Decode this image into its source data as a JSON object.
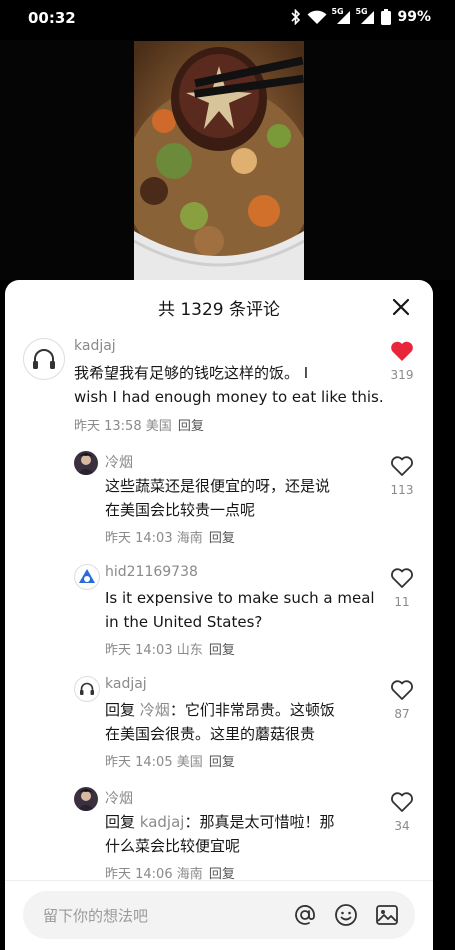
{
  "status_bar": {
    "time": "00:32",
    "signal1": "5G",
    "signal2": "5G",
    "battery": "99%"
  },
  "sheet": {
    "title": "共 1329 条评论"
  },
  "comments": [
    {
      "user": "kadjaj",
      "text_line1": "我希望我有足够的钱吃这样的饭。 I",
      "text_line2": "wish I had enough money to eat like this.",
      "time": "昨天 13:58",
      "location": "美国",
      "reply_label": "回复",
      "likes": "319",
      "liked": true
    },
    {
      "user": "冷烟",
      "text_line1": "这些蔬菜还是很便宜的呀，还是说",
      "text_line2": "在美国会比较贵一点呢",
      "time": "昨天 14:03",
      "location": "海南",
      "reply_label": "回复",
      "likes": "113",
      "liked": false
    },
    {
      "user": "hid21169738",
      "text_line1": "Is it expensive to make such a meal",
      "text_line2": "in the United States?",
      "time": "昨天 14:03",
      "location": "山东",
      "reply_label": "回复",
      "likes": "11",
      "liked": false
    },
    {
      "user": "kadjaj",
      "reply_prefix": "回复",
      "reply_to": "冷烟",
      "text_line1_rest": "：它们非常昂贵。这顿饭",
      "text_line2": "在美国会很贵。这里的蘑菇很贵",
      "time": "昨天 14:05",
      "location": "美国",
      "reply_label": "回复",
      "likes": "87",
      "liked": false
    },
    {
      "user": "冷烟",
      "reply_prefix": "回复",
      "reply_to": "kadjaj",
      "text_line1_rest": "：那真是太可惜啦！那",
      "text_line2": "什么菜会比较便宜呢",
      "time": "昨天 14:06",
      "location": "海南",
      "reply_label": "回复",
      "likes": "34",
      "liked": false
    }
  ],
  "input": {
    "placeholder": "留下你的想法吧"
  },
  "colors": {
    "like_active": "#e8253a",
    "sheet_bg": "#ffffff",
    "muted_text": "#8a8a8a"
  },
  "icons": [
    "at-icon",
    "emoji-icon",
    "image-icon",
    "close-icon",
    "heart-icon"
  ]
}
